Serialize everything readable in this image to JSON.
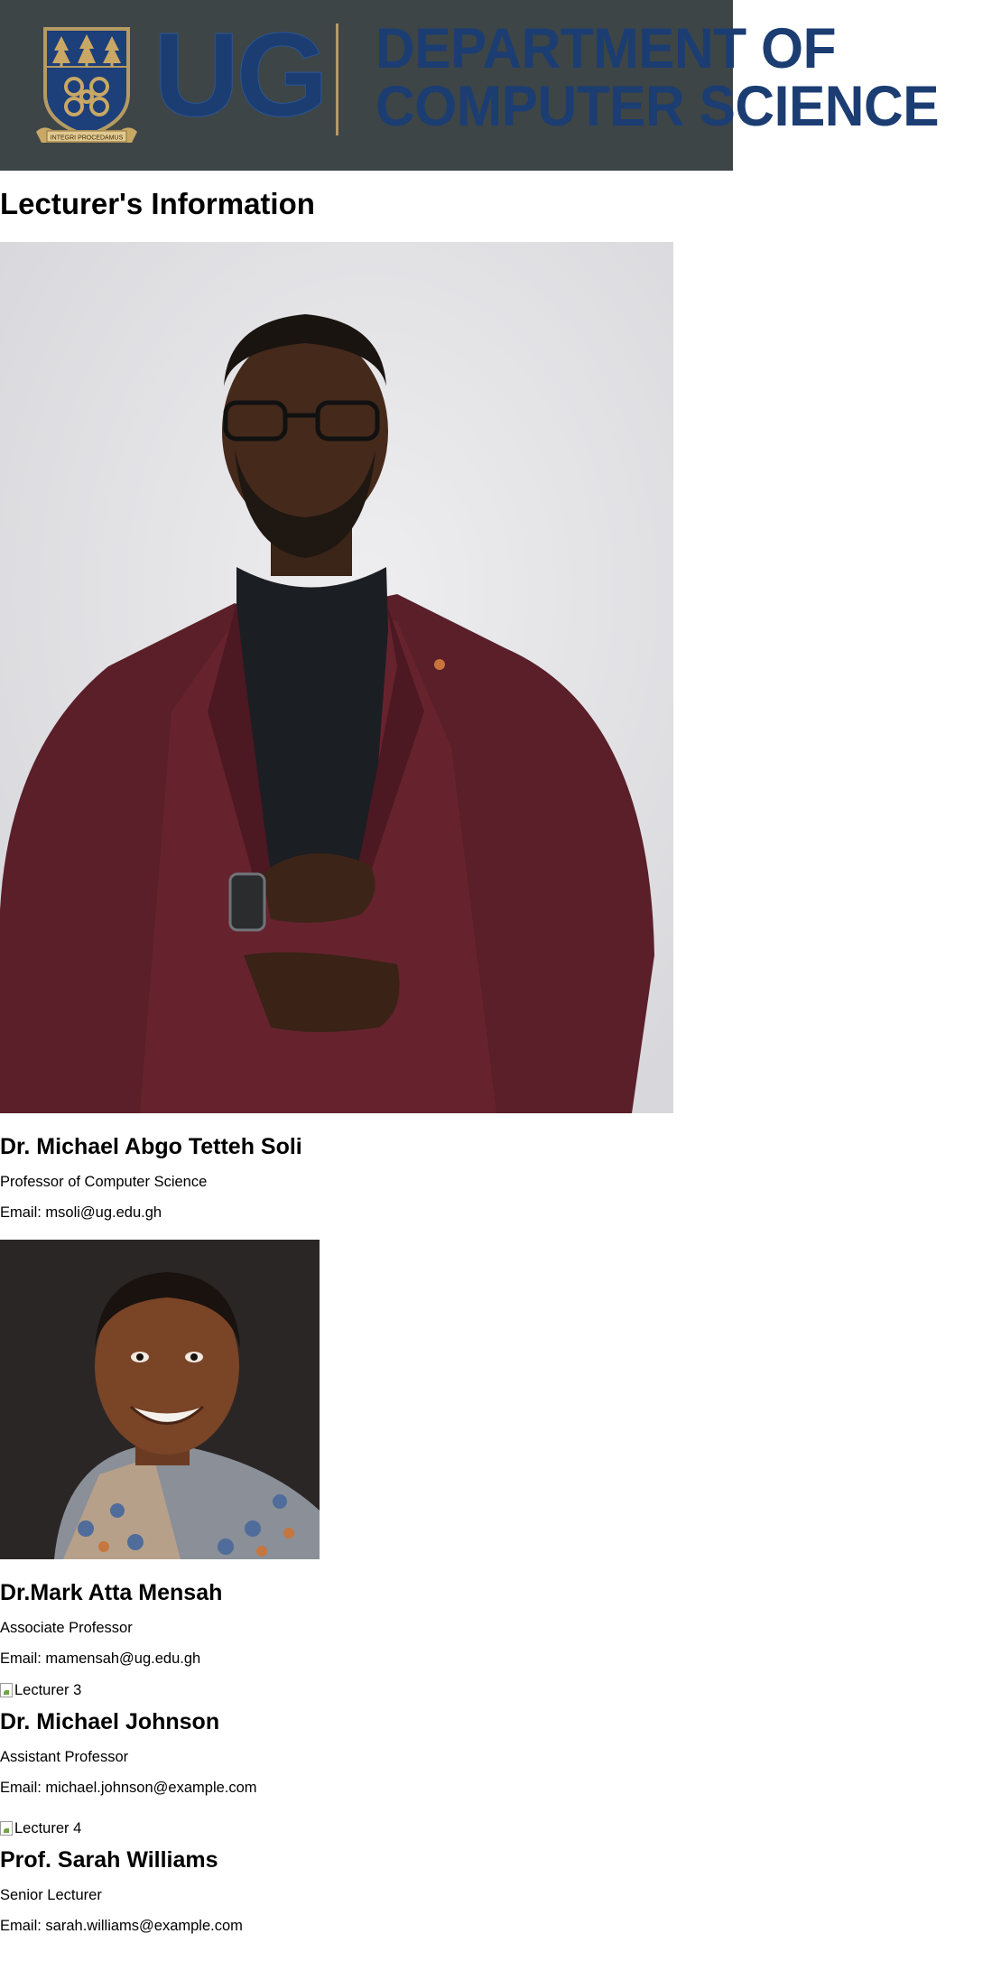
{
  "header": {
    "logo_abbrev": "UG",
    "dept_line1": "DEPARTMENT OF",
    "dept_line2": "COMPUTER SCIENCE",
    "crest_motto": "INTEGRI PROCEDAMUS",
    "colors": {
      "banner_bg": "#3d4547",
      "brand_blue": "#1b3d72",
      "gold": "#b59a62"
    }
  },
  "page_title": "Lecturer's Information",
  "lecturers": [
    {
      "name": "Dr. Michael Abgo Tetteh Soli",
      "position": "Professor of Computer Science",
      "email": "Email: msoli@ug.edu.gh",
      "photo_alt": ""
    },
    {
      "name": "Dr.Mark Atta Mensah",
      "position": "Associate Professor",
      "email": "Email: mamensah@ug.edu.gh",
      "photo_alt": ""
    },
    {
      "name": "Dr. Michael Johnson",
      "position": "Assistant Professor",
      "email": "Email: michael.johnson@example.com",
      "photo_alt": "Lecturer 3"
    },
    {
      "name": "Prof. Sarah Williams",
      "position": "Senior Lecturer",
      "email": "Email: sarah.williams@example.com",
      "photo_alt": "Lecturer 4"
    }
  ]
}
